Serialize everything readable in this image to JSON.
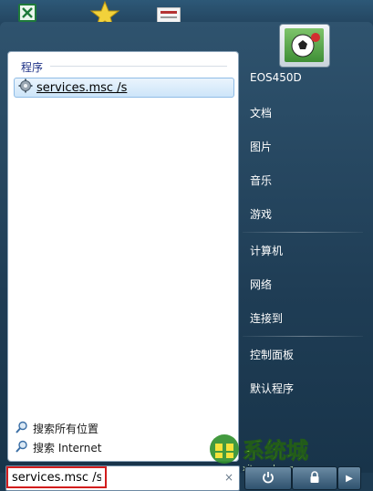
{
  "search_results": {
    "section_title": "程序",
    "items": [
      {
        "label": "services.msc /s",
        "icon": "gear-icon"
      }
    ]
  },
  "search_links": [
    {
      "label": "搜索所有位置",
      "icon": "magnifier-icon"
    },
    {
      "label": "搜索 Internet",
      "icon": "magnifier-icon"
    }
  ],
  "search_box": {
    "value": "services.msc /s",
    "clear_icon": "×"
  },
  "right_pane": {
    "items": [
      {
        "label": "EOS450D"
      },
      {
        "label": "文档"
      },
      {
        "label": "图片"
      },
      {
        "label": "音乐"
      },
      {
        "label": "游戏"
      },
      {
        "label": "计算机"
      },
      {
        "label": "网络"
      },
      {
        "label": "连接到"
      },
      {
        "label": "控制面板"
      },
      {
        "label": "默认程序"
      }
    ]
  },
  "bottom_buttons": {
    "power_icon": "power-icon",
    "lock_icon": "lock-icon",
    "arrow": "▶"
  },
  "watermark": {
    "text": "系统城",
    "site": "xitongcheng.com"
  },
  "colors": {
    "menu_bg": "#2f536e",
    "highlight": "#cde5f9",
    "search_highlight_border": "#d21d1d"
  }
}
